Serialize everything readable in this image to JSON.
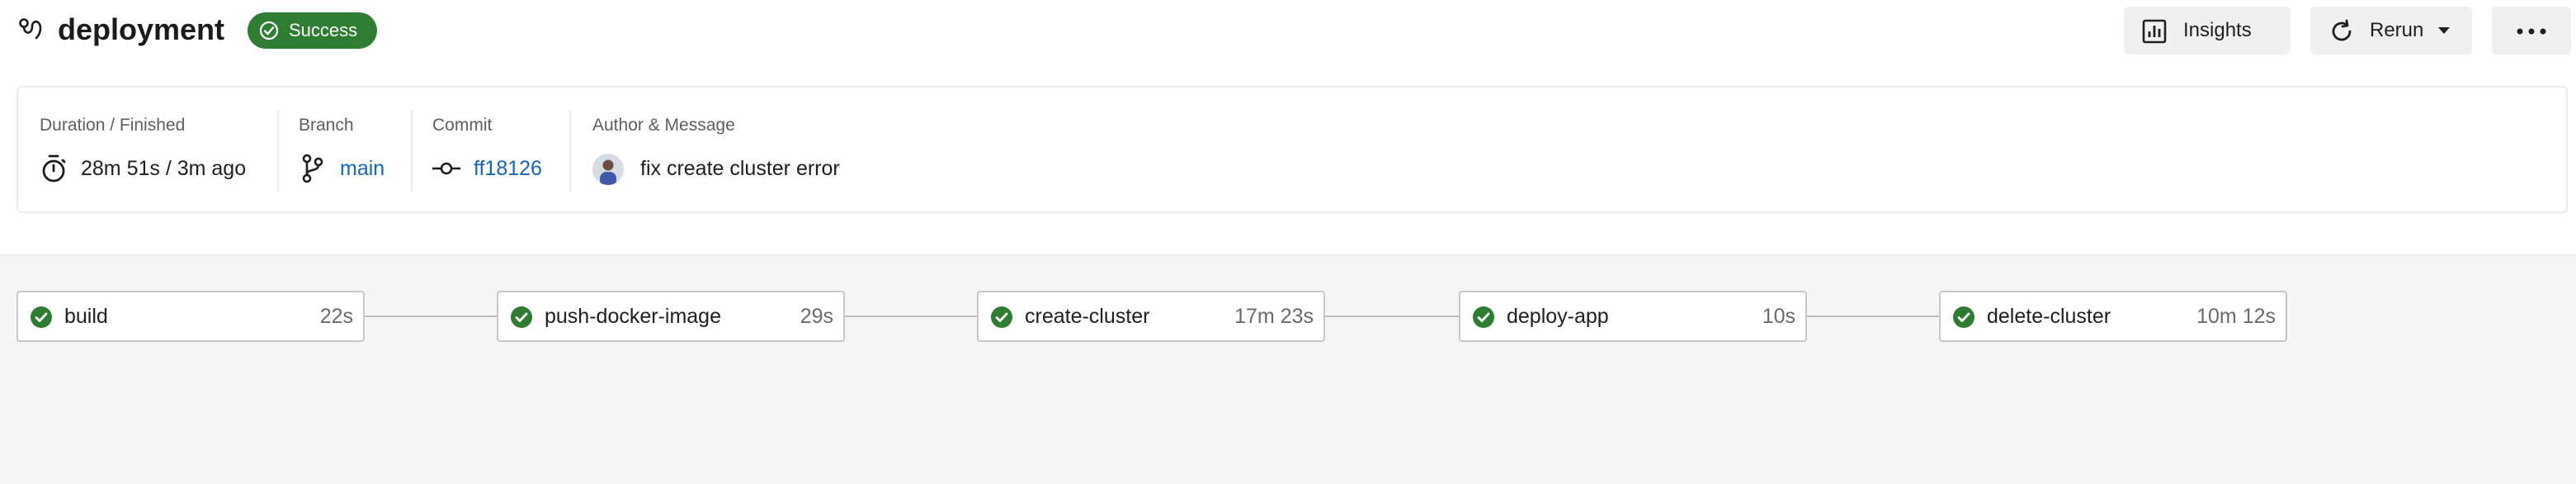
{
  "workflow": {
    "title": "deployment",
    "status": "Success",
    "colors": {
      "success": "#2e7d32",
      "link": "#1565c0"
    }
  },
  "toolbar": {
    "insights_label": "Insights",
    "rerun_label": "Rerun",
    "more_icon": "ellipsis-icon"
  },
  "info": {
    "duration": {
      "label": "Duration / Finished",
      "value": "28m 51s / 3m ago",
      "icon": "stopwatch-icon"
    },
    "branch": {
      "label": "Branch",
      "value": "main",
      "icon": "git-branch-icon"
    },
    "commit": {
      "label": "Commit",
      "value": "ff18126",
      "icon": "git-commit-icon"
    },
    "author": {
      "label": "Author & Message",
      "message": "fix create cluster error",
      "icon": "avatar"
    }
  },
  "jobs": [
    {
      "name": "build",
      "duration": "22s",
      "status": "success"
    },
    {
      "name": "push-docker-image",
      "duration": "29s",
      "status": "success"
    },
    {
      "name": "create-cluster",
      "duration": "17m 23s",
      "status": "success"
    },
    {
      "name": "deploy-app",
      "duration": "10s",
      "status": "success"
    },
    {
      "name": "delete-cluster",
      "duration": "10m 12s",
      "status": "success"
    }
  ]
}
